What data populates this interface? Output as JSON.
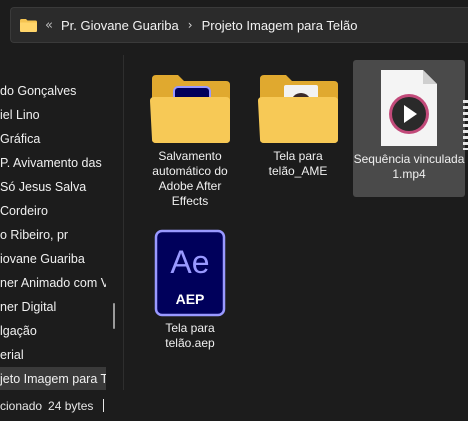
{
  "breadcrumb": {
    "overflow": "«",
    "items": [
      "Pr. Giovane Guariba",
      "Projeto Imagem para Telão"
    ],
    "separator": "›"
  },
  "sidebar": {
    "items": [
      {
        "label": "do Gonçalves"
      },
      {
        "label": "iel Lino"
      },
      {
        "label": " Gráfica"
      },
      {
        "label": "P. Avivamento das N"
      },
      {
        "label": "Só Jesus Salva"
      },
      {
        "label": "Cordeiro"
      },
      {
        "label": "o Ribeiro, pr"
      },
      {
        "label": "iovane Guariba"
      },
      {
        "label": "ner Animado com Vi"
      },
      {
        "label": "ner Digital"
      },
      {
        "label": "lgação"
      },
      {
        "label": "erial"
      },
      {
        "label": "jeto Imagem para Tel"
      }
    ]
  },
  "files": [
    {
      "label": "Salvamento automático do Adobe After Effects",
      "icon": "folder-after-effects-icon"
    },
    {
      "label": "Tela para telão_AME",
      "icon": "folder-media-encoder-icon"
    },
    {
      "label": "Sequência vinculada 1.mp4",
      "icon": "video-file-icon",
      "selected": true
    },
    {
      "label": "Tela para telão.aep",
      "icon": "after-effects-project-icon",
      "badge": "AEP",
      "logo": "Ae"
    }
  ],
  "status": {
    "selection": "cionado",
    "size": "24 bytes"
  },
  "colors": {
    "folder": "#f5c451",
    "ae_purple": "#9999ff",
    "ae_dark": "#00005b"
  }
}
